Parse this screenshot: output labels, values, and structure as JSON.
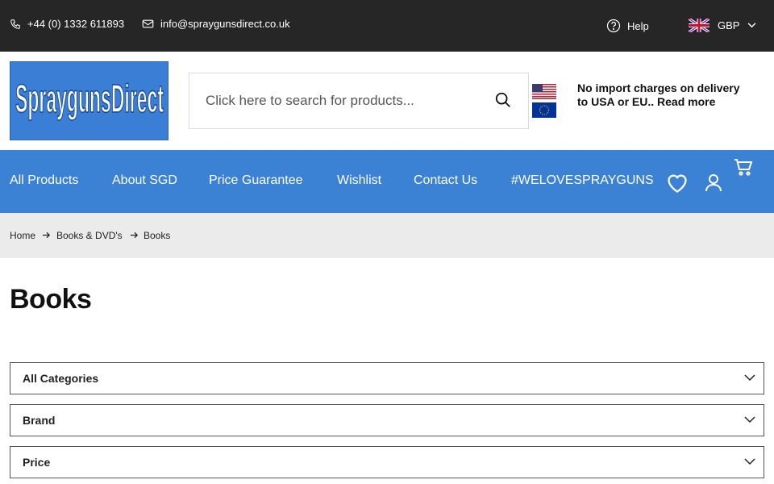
{
  "topbar": {
    "phone": "+44 (0) 1332 611893",
    "email": "info@spraygunsdirect.co.uk",
    "help": "Help",
    "currency": "GBP"
  },
  "header": {
    "logo_text": "SpraygunsDirect",
    "search_placeholder": "Click here to search for products...",
    "import_note": "No import charges on delivery to USA or EU.. Read more"
  },
  "nav": {
    "items": [
      {
        "label": "All Products"
      },
      {
        "label": "About SGD"
      },
      {
        "label": "Price Guarantee"
      },
      {
        "label": "Wishlist"
      },
      {
        "label": "Contact Us"
      },
      {
        "label": "#WELOVESPRAYGUNS"
      }
    ]
  },
  "breadcrumb": {
    "items": [
      "Home",
      "Books & DVD's",
      "Books"
    ]
  },
  "page": {
    "title": "Books"
  },
  "filters": [
    {
      "label": "All Categories"
    },
    {
      "label": "Brand"
    },
    {
      "label": "Price"
    }
  ],
  "colors": {
    "topbar": "#262626",
    "nav": "#3b82d4",
    "logo_bg": "#3a7ed6",
    "breadcrumb_bg": "#ebebeb"
  }
}
